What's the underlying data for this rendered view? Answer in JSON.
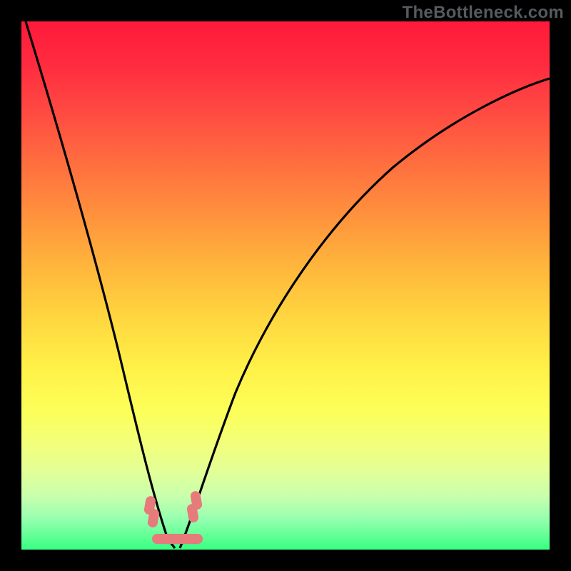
{
  "watermark": "TheBottleneck.com",
  "chart_data": {
    "type": "line",
    "title": "",
    "xlabel": "",
    "ylabel": "",
    "xlim": [
      0,
      100
    ],
    "ylim": [
      0,
      100
    ],
    "grid": false,
    "legend": false,
    "background": "vertical-gradient-red-to-green",
    "series": [
      {
        "name": "left-curve",
        "x": [
          0,
          4,
          8,
          12,
          16,
          19,
          22,
          24.5,
          26.5,
          28,
          29.5
        ],
        "values": [
          100,
          79,
          60,
          44,
          31,
          22,
          14,
          8,
          4,
          1.5,
          0.5
        ]
      },
      {
        "name": "right-curve",
        "x": [
          29.5,
          31,
          33,
          36,
          40,
          46,
          54,
          64,
          76,
          90,
          100
        ],
        "values": [
          0.5,
          2,
          5,
          10,
          17,
          27,
          39,
          52,
          66,
          79,
          87
        ]
      }
    ],
    "highlight_region": {
      "description": "minimum / optimal zone",
      "x_range": [
        23,
        35
      ],
      "y_range": [
        0,
        10
      ],
      "marker_color": "#e77a7a"
    }
  }
}
